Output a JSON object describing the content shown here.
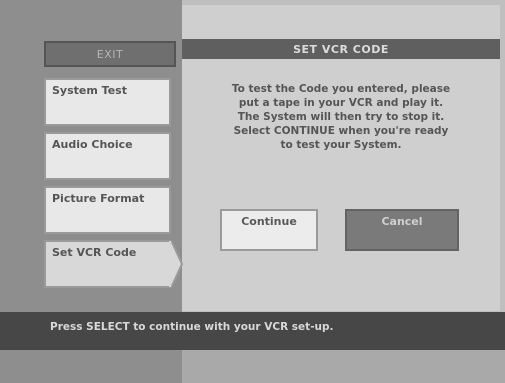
{
  "menu": {
    "exit_label": "EXIT",
    "items": [
      {
        "label": "System Test"
      },
      {
        "label": "Audio Choice"
      },
      {
        "label": "Picture Format"
      },
      {
        "label": "Set VCR Code"
      }
    ],
    "selected_index": 3
  },
  "panel": {
    "title": "SET VCR CODE",
    "instruction_lines": [
      "To test the Code you entered, please",
      "put a tape in your VCR and play it.",
      "The System will then try to stop it.",
      "Select CONTINUE when you're ready",
      "to test your System."
    ],
    "continue_label": "Continue",
    "cancel_label": "Cancel"
  },
  "status": {
    "text": "Press SELECT to continue with your VCR set-up."
  }
}
